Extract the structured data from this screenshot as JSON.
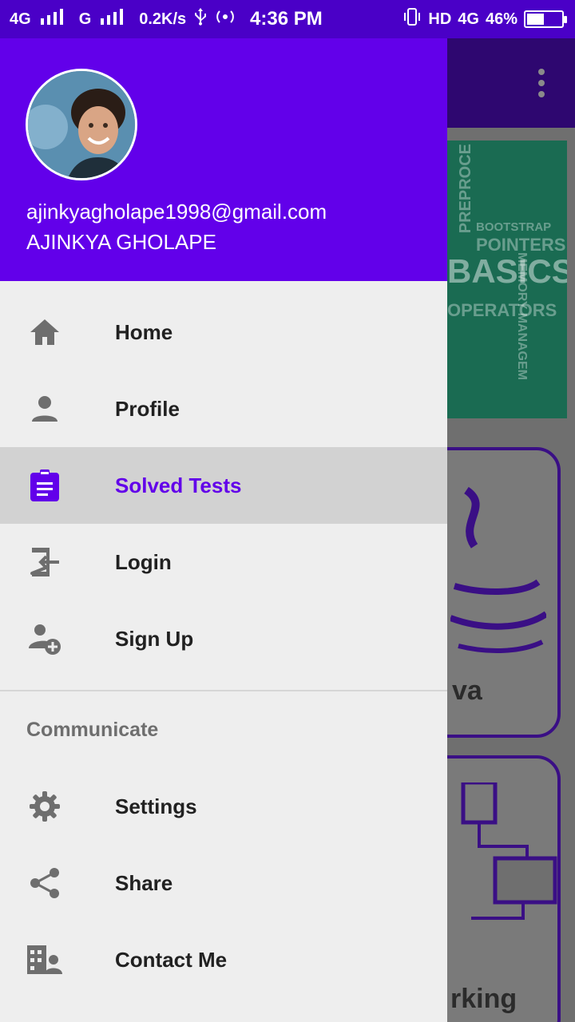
{
  "status_bar": {
    "network_left": "4G",
    "network_g": "G",
    "speed": "0.2K/s",
    "time": "4:36 PM",
    "hd": "HD",
    "network_right": "4G",
    "battery_percent": "46%",
    "battery_level": 0.46
  },
  "drawer": {
    "email": "ajinkyagholape1998@gmail.com",
    "name": "AJINKYA GHOLAPE",
    "items": [
      {
        "label": "Home",
        "icon": "home-icon"
      },
      {
        "label": "Profile",
        "icon": "person-icon"
      },
      {
        "label": "Solved Tests",
        "icon": "clipboard-icon",
        "active": true
      },
      {
        "label": "Login",
        "icon": "login-icon"
      },
      {
        "label": "Sign Up",
        "icon": "add-user-icon"
      }
    ],
    "section_title": "Communicate",
    "section_items": [
      {
        "label": "Settings",
        "icon": "gear-icon"
      },
      {
        "label": "Share",
        "icon": "share-icon"
      },
      {
        "label": "Contact Me",
        "icon": "contact-icon"
      }
    ]
  },
  "background": {
    "banner_words": [
      "PREPROCE",
      "BOOTSTRAP",
      "POINTERS",
      "BASICS",
      "OPERATORS",
      "MEMORY MANAGEM"
    ],
    "card1_label": "va",
    "card2_label": "rking"
  },
  "colors": {
    "primary": "#6200ea",
    "status_bar": "#4a00c7",
    "scrim_background": "#6f6f6f",
    "active_item_bg": "#d2d2d2"
  }
}
